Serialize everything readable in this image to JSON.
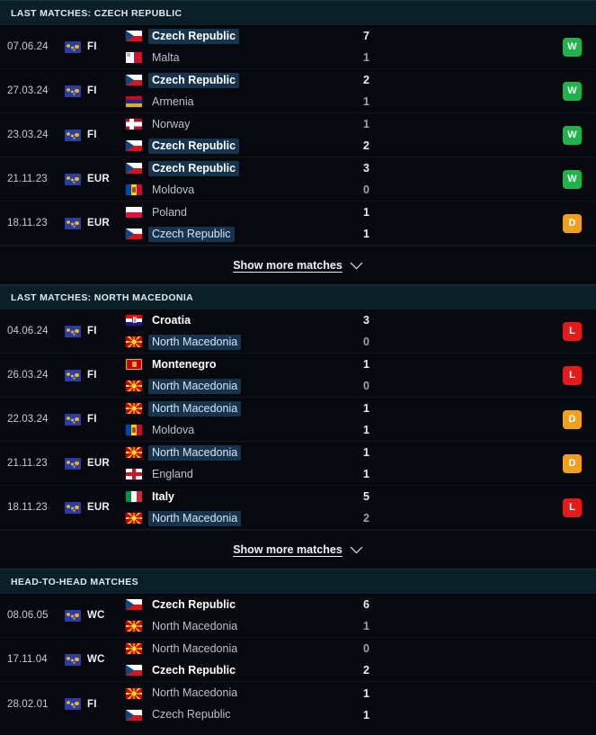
{
  "sections": [
    {
      "id": "last-matches-czech",
      "title": "LAST MATCHES: CZECH REPUBLIC",
      "show_more_label": "Show more matches",
      "has_show_more": true,
      "has_result_badge": true,
      "matches": [
        {
          "date": "07.06.24",
          "competition": "FI",
          "home": {
            "name": "Czech Republic",
            "flag": "cz",
            "bold": true,
            "highlight": true
          },
          "away": {
            "name": "Malta",
            "flag": "mt",
            "bold": false,
            "highlight": false
          },
          "home_score": "7",
          "away_score": "1",
          "result": "W"
        },
        {
          "date": "27.03.24",
          "competition": "FI",
          "home": {
            "name": "Czech Republic",
            "flag": "cz",
            "bold": true,
            "highlight": true
          },
          "away": {
            "name": "Armenia",
            "flag": "am",
            "bold": false,
            "highlight": false
          },
          "home_score": "2",
          "away_score": "1",
          "result": "W"
        },
        {
          "date": "23.03.24",
          "competition": "FI",
          "home": {
            "name": "Norway",
            "flag": "no",
            "bold": false,
            "highlight": false
          },
          "away": {
            "name": "Czech Republic",
            "flag": "cz",
            "bold": true,
            "highlight": true
          },
          "home_score": "1",
          "away_score": "2",
          "result": "W"
        },
        {
          "date": "21.11.23",
          "competition": "EUR",
          "home": {
            "name": "Czech Republic",
            "flag": "cz",
            "bold": true,
            "highlight": true
          },
          "away": {
            "name": "Moldova",
            "flag": "md",
            "bold": false,
            "highlight": false
          },
          "home_score": "3",
          "away_score": "0",
          "result": "W"
        },
        {
          "date": "18.11.23",
          "competition": "EUR",
          "home": {
            "name": "Poland",
            "flag": "pl",
            "bold": false,
            "highlight": false
          },
          "away": {
            "name": "Czech Republic",
            "flag": "cz",
            "bold": false,
            "highlight": true
          },
          "home_score": "1",
          "away_score": "1",
          "result": "D"
        }
      ]
    },
    {
      "id": "last-matches-north-macedonia",
      "title": "LAST MATCHES: NORTH MACEDONIA",
      "show_more_label": "Show more matches",
      "has_show_more": true,
      "has_result_badge": true,
      "matches": [
        {
          "date": "04.06.24",
          "competition": "FI",
          "home": {
            "name": "Croatia",
            "flag": "hr",
            "bold": true,
            "highlight": false
          },
          "away": {
            "name": "North Macedonia",
            "flag": "mk",
            "bold": false,
            "highlight": true
          },
          "home_score": "3",
          "away_score": "0",
          "result": "L"
        },
        {
          "date": "26.03.24",
          "competition": "FI",
          "home": {
            "name": "Montenegro",
            "flag": "me",
            "bold": true,
            "highlight": false
          },
          "away": {
            "name": "North Macedonia",
            "flag": "mk",
            "bold": false,
            "highlight": true
          },
          "home_score": "1",
          "away_score": "0",
          "result": "L"
        },
        {
          "date": "22.03.24",
          "competition": "FI",
          "home": {
            "name": "North Macedonia",
            "flag": "mk",
            "bold": false,
            "highlight": true
          },
          "away": {
            "name": "Moldova",
            "flag": "md",
            "bold": false,
            "highlight": false
          },
          "home_score": "1",
          "away_score": "1",
          "result": "D"
        },
        {
          "date": "21.11.23",
          "competition": "EUR",
          "home": {
            "name": "North Macedonia",
            "flag": "mk",
            "bold": false,
            "highlight": true
          },
          "away": {
            "name": "England",
            "flag": "en",
            "bold": false,
            "highlight": false
          },
          "home_score": "1",
          "away_score": "1",
          "result": "D"
        },
        {
          "date": "18.11.23",
          "competition": "EUR",
          "home": {
            "name": "Italy",
            "flag": "it",
            "bold": true,
            "highlight": false
          },
          "away": {
            "name": "North Macedonia",
            "flag": "mk",
            "bold": false,
            "highlight": true
          },
          "home_score": "5",
          "away_score": "2",
          "result": "L"
        }
      ]
    },
    {
      "id": "head-to-head-matches",
      "title": "HEAD-TO-HEAD MATCHES",
      "show_more_label": "",
      "has_show_more": false,
      "has_result_badge": false,
      "matches": [
        {
          "date": "08.06.05",
          "competition": "WC",
          "home": {
            "name": "Czech Republic",
            "flag": "cz",
            "bold": true,
            "highlight": false
          },
          "away": {
            "name": "North Macedonia",
            "flag": "mk",
            "bold": false,
            "highlight": false
          },
          "home_score": "6",
          "away_score": "1",
          "result": ""
        },
        {
          "date": "17.11.04",
          "competition": "WC",
          "home": {
            "name": "North Macedonia",
            "flag": "mk",
            "bold": false,
            "highlight": false
          },
          "away": {
            "name": "Czech Republic",
            "flag": "cz",
            "bold": true,
            "highlight": false
          },
          "home_score": "0",
          "away_score": "2",
          "result": ""
        },
        {
          "date": "28.02.01",
          "competition": "FI",
          "home": {
            "name": "North Macedonia",
            "flag": "mk",
            "bold": false,
            "highlight": false
          },
          "away": {
            "name": "Czech Republic",
            "flag": "cz",
            "bold": false,
            "highlight": false
          },
          "home_score": "1",
          "away_score": "1",
          "result": ""
        }
      ]
    }
  ],
  "icons": {
    "competition": "globe-icon",
    "chevron": "chevron-down-icon"
  },
  "colors": {
    "win": "#22b24c",
    "loss": "#e31b1b",
    "draw": "#f0a020",
    "header_bg": "#0b1f28",
    "page_bg": "#06090f",
    "highlight": "#17344f"
  }
}
